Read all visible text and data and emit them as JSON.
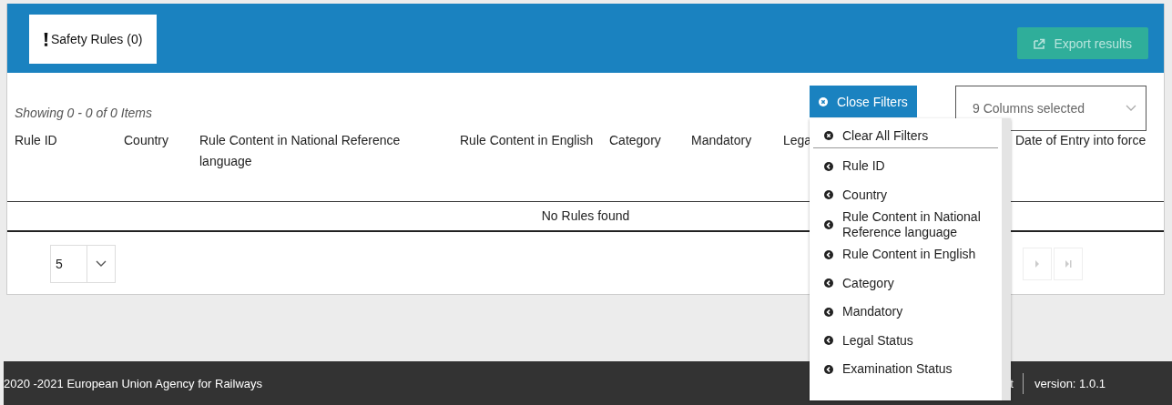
{
  "tabs": [
    {
      "label": "Safety Rules (0)",
      "selected": true
    }
  ],
  "export_button": {
    "label": "Export results",
    "disabled": true
  },
  "summary": "Showing 0 - 0 of 0 Items",
  "filters_button": {
    "label": "Close Filters"
  },
  "columns_select": {
    "value": "9 Columns selected"
  },
  "table": {
    "columns": [
      "Rule ID",
      "Country",
      "Rule Content in National Reference language",
      "Rule Content in English",
      "Category",
      "Mandatory",
      "Lega",
      "Date of Entry into force"
    ],
    "empty_message": "No Rules found"
  },
  "pager": {
    "page_size": "5",
    "next_disabled": true,
    "last_disabled": true
  },
  "filter_menu": [
    {
      "kind": "clear",
      "label": "Clear All Filters"
    },
    {
      "kind": "column",
      "label": "Rule ID"
    },
    {
      "kind": "column",
      "label": "Country"
    },
    {
      "kind": "column",
      "label": "Rule Content in National Reference language"
    },
    {
      "kind": "column",
      "label": "Rule Content in English"
    },
    {
      "kind": "column",
      "label": "Category"
    },
    {
      "kind": "column",
      "label": "Mandatory"
    },
    {
      "kind": "column",
      "label": "Legal Status"
    },
    {
      "kind": "column",
      "label": "Examination Status"
    }
  ],
  "footer": {
    "copyright": "2020 -2021 European Union Agency for Railways",
    "link": "t",
    "version": "version: 1.0.1"
  }
}
